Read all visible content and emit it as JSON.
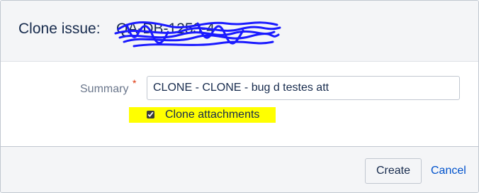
{
  "dialog": {
    "title_prefix": "Clone issue:",
    "issue_key": "QA-DB-1253-4",
    "scribble_color": "#1a1aff"
  },
  "form": {
    "summary_label": "Summary",
    "required_marker": "*",
    "summary_value": "CLONE - CLONE - bug d testes att",
    "clone_attachments_label": "Clone attachments",
    "clone_attachments_checked": true,
    "highlight_color": "#ffff00"
  },
  "footer": {
    "create_label": "Create",
    "cancel_label": "Cancel"
  }
}
